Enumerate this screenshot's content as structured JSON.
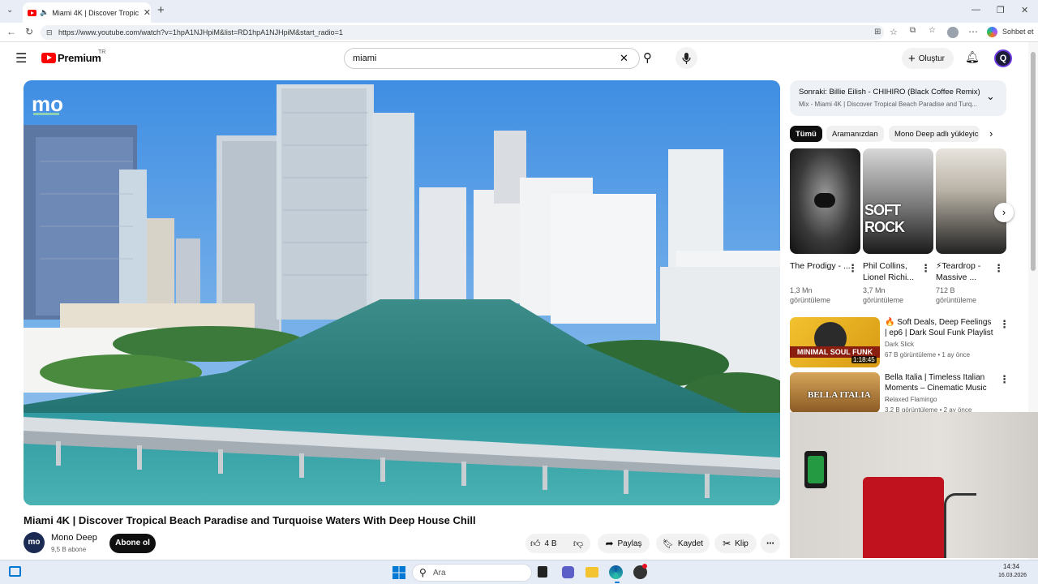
{
  "browser": {
    "tab_title": "Miami 4K | Discover Tropical Beach",
    "url": "https://www.youtube.com/watch?v=1hpA1NJHpiM&list=RD1hpA1NJHpiM&start_radio=1",
    "chat_label": "Sohbet et"
  },
  "yt": {
    "logo_text": "Premium",
    "region": "TR",
    "search_value": "miami",
    "create_label": "Oluştur",
    "avatar_letter": "Q"
  },
  "video": {
    "channel_logo": "mo",
    "title": "Miami 4K | Discover Tropical Beach Paradise and Turquoise Waters With Deep House Chill",
    "channel_name": "Mono Deep",
    "subscribers": "9,5 B abone",
    "subscribe_label": "Abone ol",
    "likes": "4 B",
    "share_label": "Paylaş",
    "save_label": "Kaydet",
    "clip_label": "Klip"
  },
  "sidebar": {
    "next_label": "Sonraki: Billie Eilish - CHIHIRO (Black Coffee Remix)",
    "mix_label": "Mix - Miami 4K | Discover Tropical Beach Paradise and Turq...",
    "chips": [
      "Tümü",
      "Aramanızdan",
      "Mono Deep adlı yükleyic"
    ],
    "cards": [
      {
        "title": "The Prodigy - ...",
        "views": "1,3 Mn",
        "views2": "görüntüleme"
      },
      {
        "title": "Phil Collins, Lionel Richi...",
        "views": "3,7 Mn",
        "views2": "görüntüleme"
      },
      {
        "title": "⚡Teardrop - Massive ...",
        "views": "712 B",
        "views2": "görüntüleme"
      }
    ],
    "card2_overlay": "SOFT ROCK",
    "videos": [
      {
        "title": "🔥 Soft Deals, Deep Feelings | ep6 | Dark Soul Funk Playlist",
        "channel": "Dark Slick",
        "meta": "67 B görüntüleme • 1 ay önce",
        "duration": "1:18:45",
        "thumb_text": "MINIMAL SOUL FUNK"
      },
      {
        "title": "Bella Italia | Timeless Italian Moments – Cinematic Music ...",
        "channel": "Relaxed Flamingo",
        "meta": "3,2 B görüntüleme • 2 ay önce",
        "thumb_text": "BELLA ITALIA"
      }
    ]
  },
  "taskbar": {
    "search_label": "Ara",
    "time": "14:34",
    "date": "16.03.2026"
  },
  "colors": {
    "brand_red": "#ff0000",
    "subscribe_bg": "#0f0f0f",
    "windows_blue": "#0078d4"
  }
}
